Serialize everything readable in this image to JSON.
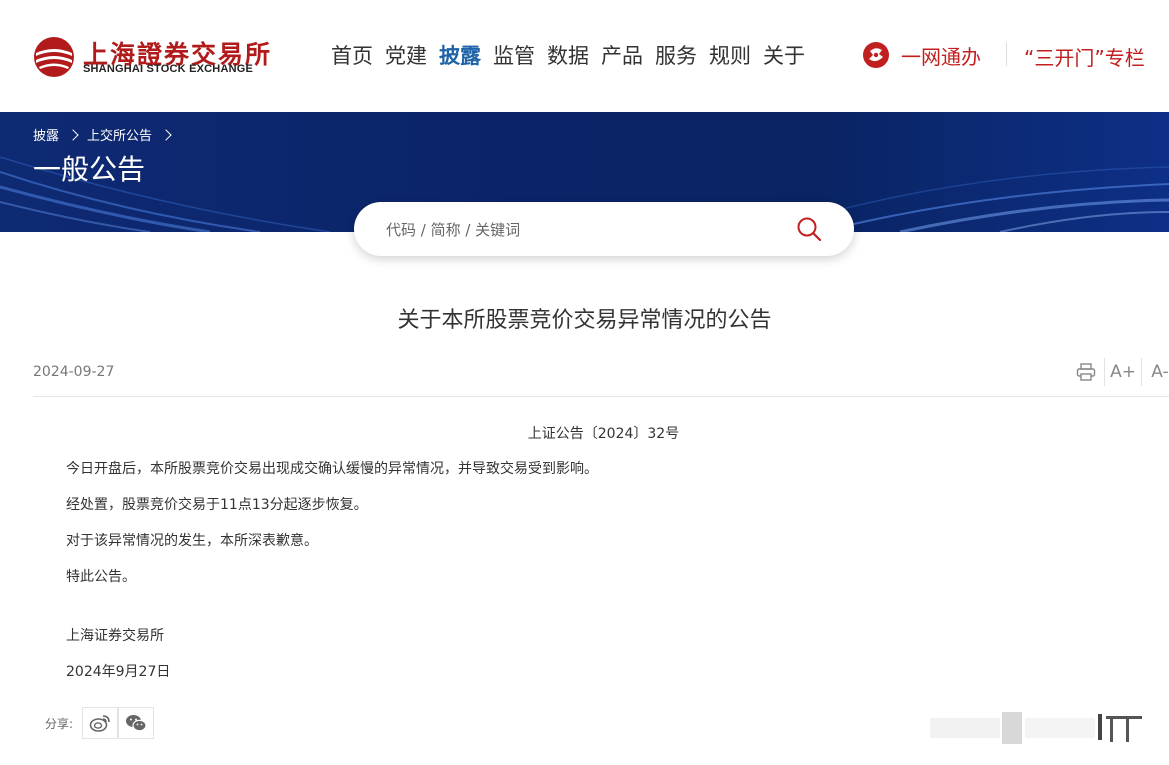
{
  "header": {
    "logo_cn": "上海證券交易所",
    "logo_en": "SHANGHAI STOCK EXCHANGE",
    "nav": [
      {
        "label": "首页",
        "active": false
      },
      {
        "label": "党建",
        "active": false
      },
      {
        "label": "披露",
        "active": true
      },
      {
        "label": "监管",
        "active": false
      },
      {
        "label": "数据",
        "active": false
      },
      {
        "label": "产品",
        "active": false
      },
      {
        "label": "服务",
        "active": false
      },
      {
        "label": "规则",
        "active": false
      },
      {
        "label": "关于",
        "active": false
      }
    ],
    "ywtb_label": "一网通办",
    "skm_label": "“三开门”专栏"
  },
  "banner": {
    "breadcrumb": [
      "披露",
      "上交所公告"
    ],
    "title": "一般公告"
  },
  "search": {
    "placeholder": "代码 / 简称 / 关键词"
  },
  "article": {
    "title": "关于本所股票竞价交易异常情况的公告",
    "date": "2024-09-27",
    "tools": {
      "print": "print-icon",
      "font_up": "A+",
      "font_down": "A-"
    },
    "doc_number": "上证公告〔2024〕32号",
    "paragraphs": [
      "今日开盘后，本所股票竞价交易出现成交确认缓慢的异常情况，并导致交易受到影响。",
      "经处置，股票竞价交易于11点13分起逐步恢复。",
      "对于该异常情况的发生，本所深表歉意。",
      "特此公告。"
    ],
    "signature": "上海证券交易所",
    "signature_date": "2024年9月27日"
  },
  "share": {
    "label": "分享:",
    "icons": [
      "weibo-icon",
      "wechat-icon"
    ]
  },
  "colors": {
    "brand_red": "#c0201f",
    "nav_active": "#1e62a8",
    "banner_blue": "#0b2468"
  }
}
